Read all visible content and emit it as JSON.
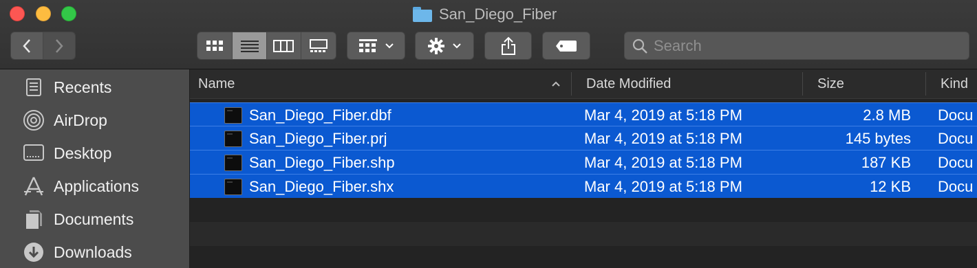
{
  "window": {
    "title": "San_Diego_Fiber"
  },
  "toolbar": {
    "search_placeholder": "Search"
  },
  "sidebar": {
    "items": [
      {
        "label": "Recents"
      },
      {
        "label": "AirDrop"
      },
      {
        "label": "Desktop"
      },
      {
        "label": "Applications"
      },
      {
        "label": "Documents"
      },
      {
        "label": "Downloads"
      }
    ]
  },
  "columns": {
    "name": "Name",
    "date": "Date Modified",
    "size": "Size",
    "kind": "Kind"
  },
  "files": [
    {
      "name": "San_Diego_Fiber.dbf",
      "date": "Mar 4, 2019 at 5:18 PM",
      "size": "2.8 MB",
      "kind": "Docu"
    },
    {
      "name": "San_Diego_Fiber.prj",
      "date": "Mar 4, 2019 at 5:18 PM",
      "size": "145 bytes",
      "kind": "Docu"
    },
    {
      "name": "San_Diego_Fiber.shp",
      "date": "Mar 4, 2019 at 5:18 PM",
      "size": "187 KB",
      "kind": "Docu"
    },
    {
      "name": "San_Diego_Fiber.shx",
      "date": "Mar 4, 2019 at 5:18 PM",
      "size": "12 KB",
      "kind": "Docu"
    }
  ],
  "colors": {
    "selection": "#0b59d1",
    "sidebar": "#4c4c4c",
    "folder": "#6db7ea"
  }
}
